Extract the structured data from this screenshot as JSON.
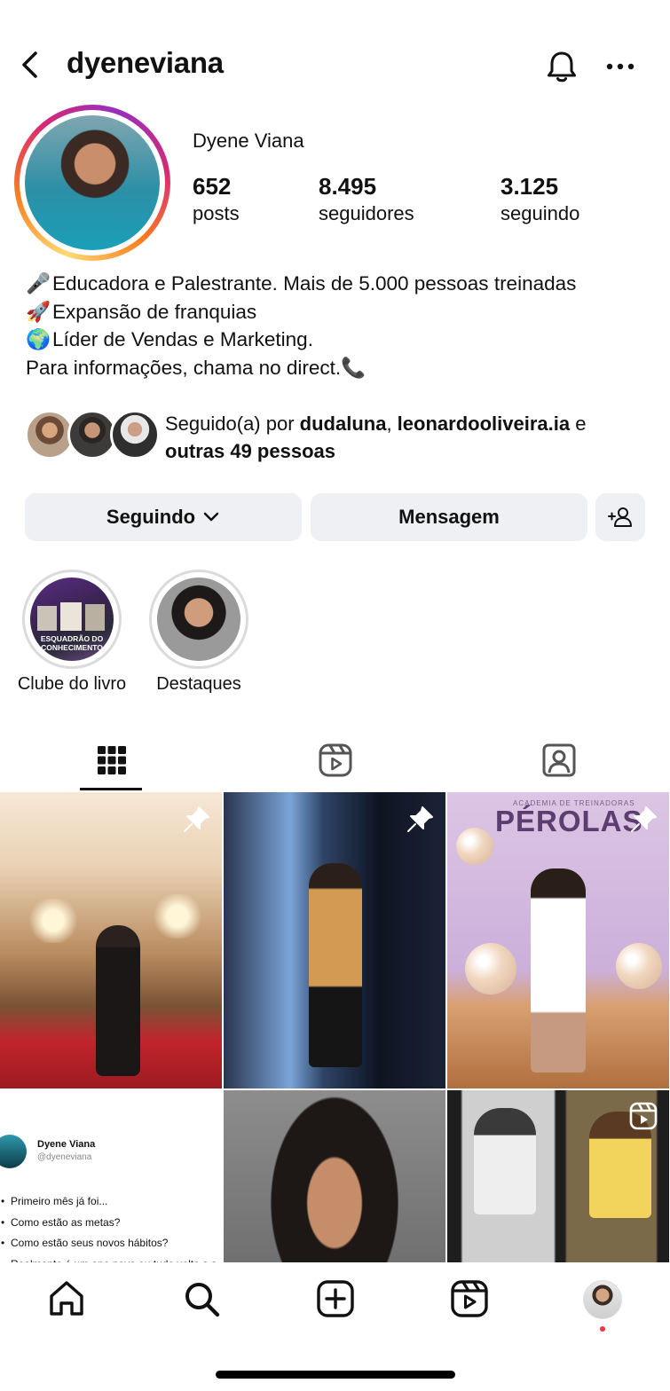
{
  "header": {
    "username": "dyeneviana"
  },
  "profile": {
    "display_name": "Dyene Viana",
    "stats": [
      {
        "value": "652",
        "label": "posts"
      },
      {
        "value": "8.495",
        "label": "seguidores"
      },
      {
        "value": "3.125",
        "label": "seguindo"
      }
    ],
    "bio": [
      {
        "emoji": "🎤",
        "text": "Educadora e Palestrante. Mais de 5.000 pessoas treinadas"
      },
      {
        "emoji": "🚀",
        "text": "Expansão de franquias"
      },
      {
        "emoji": "🌍",
        "text": "Líder de Vendas e Marketing."
      },
      {
        "emoji": "",
        "text": "Para informações, chama no direct.📞"
      }
    ],
    "followed_by": {
      "prefix": "Seguido(a) por ",
      "user1": "dudaluna",
      "sep": ", ",
      "user2": "leonardooliveira.ia",
      "suffix": " e",
      "others": "outras 49 pessoas"
    }
  },
  "actions": {
    "following": "Seguindo",
    "message": "Mensagem"
  },
  "highlights": [
    {
      "label": "Clube do livro",
      "caption": "ESQUADRÃO DO CONHECIMENTO"
    },
    {
      "label": "Destaques",
      "caption": ""
    }
  ],
  "posts": {
    "text_post": {
      "name": "Dyene Viana",
      "handle": "@dyeneviana",
      "lines": [
        "Primeiro mês já foi...",
        "Como estão as metas?",
        "Como estão seus novos hábitos?",
        "Realmente é um ano novo ou tudo volta a s"
      ]
    },
    "perolas": {
      "title": "PÉROLAS",
      "subtitle": "ACADEMIA DE TREINADORAS"
    }
  },
  "colors": {
    "button_bg": "#eef0f3",
    "notification_dot": "#ff3040",
    "story_ring": "#d62976"
  }
}
